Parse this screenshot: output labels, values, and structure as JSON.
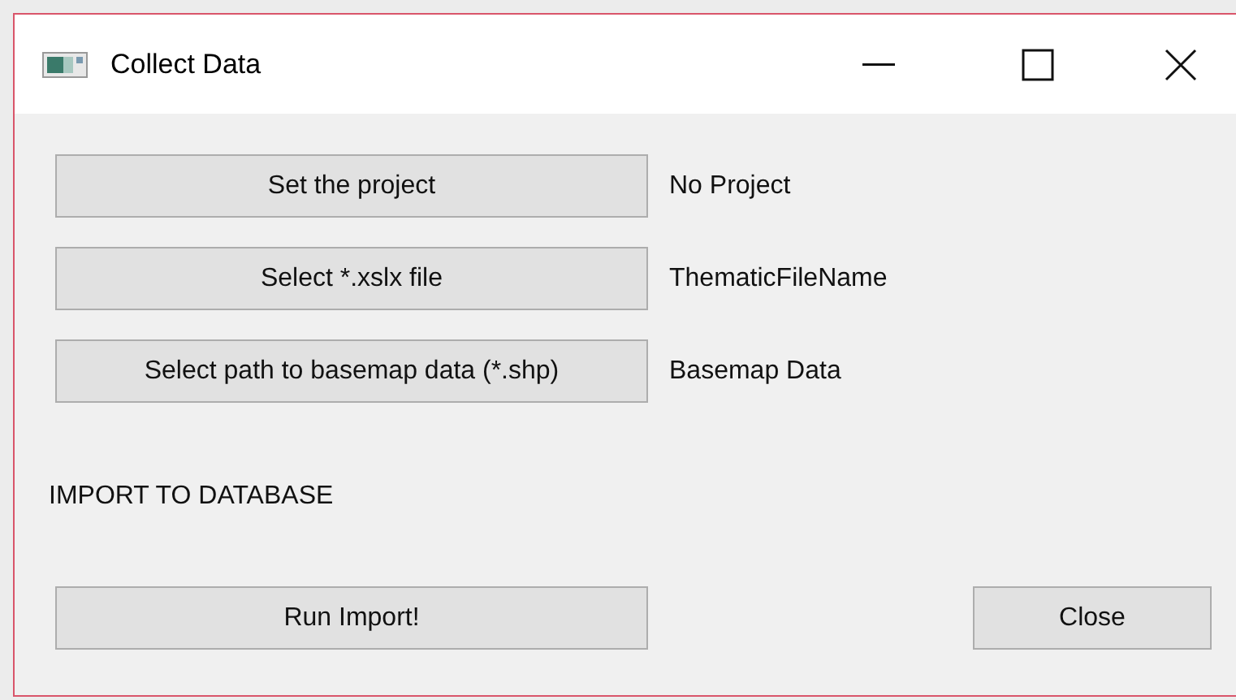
{
  "window": {
    "title": "Collect Data"
  },
  "rows": [
    {
      "button": "Set the project",
      "label": "No Project"
    },
    {
      "button": "Select *.xslx file",
      "label": "ThematicFileName"
    },
    {
      "button": "Select path to basemap data (*.shp)",
      "label": "Basemap Data"
    }
  ],
  "section_label": "IMPORT TO DATABASE",
  "buttons": [
    "Run Import!",
    "Close"
  ]
}
